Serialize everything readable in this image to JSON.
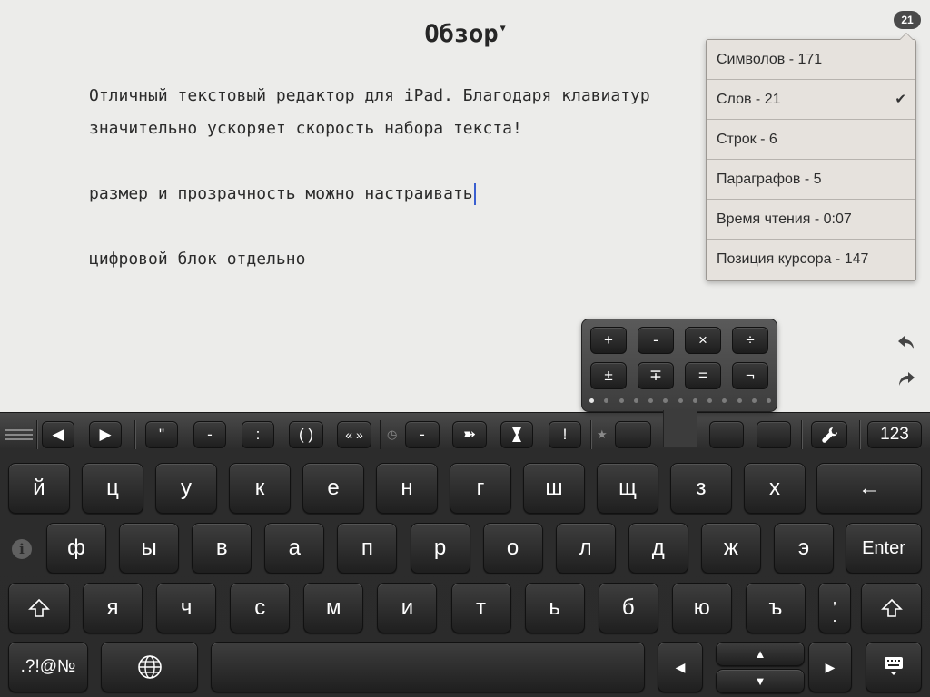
{
  "document": {
    "title": "Обзор",
    "lines": [
      "Отличный текстовый редактор для iPad. Благодаря клавиатур",
      "значительно ускоряет скорость набора текста!",
      "размер и прозрачность можно настраивать",
      "цифровой блок отдельно"
    ]
  },
  "stats": {
    "badge": "21",
    "rows": [
      {
        "label": "Символов - 171",
        "checked": false
      },
      {
        "label": "Слов - 21",
        "checked": true
      },
      {
        "label": "Строк - 6",
        "checked": false
      },
      {
        "label": "Параграфов - 5",
        "checked": false
      },
      {
        "label": "Время чтения - 0:07",
        "checked": false
      },
      {
        "label": "Позиция курсора - 147",
        "checked": false
      }
    ],
    "check_mark": "✔"
  },
  "numpad": {
    "keys": [
      "+",
      "-",
      "×",
      "÷",
      "±",
      "∓",
      "=",
      "¬"
    ],
    "page_count": 13,
    "active_page": 0
  },
  "toolbar": {
    "left_arrow": "◀",
    "right_arrow": "▶",
    "quote": "\"",
    "dash": "-",
    "colon": ":",
    "parens": "( )",
    "guillemets": "« »",
    "dash2": "-",
    "bullet_arrow": "➽",
    "exclaim": "!",
    "num_mode": "123"
  },
  "keyboard": {
    "row1": [
      "й",
      "ц",
      "у",
      "к",
      "е",
      "н",
      "г",
      "ш",
      "щ",
      "з",
      "х"
    ],
    "row2": [
      "ф",
      "ы",
      "в",
      "а",
      "п",
      "р",
      "о",
      "л",
      "д",
      "ж",
      "э"
    ],
    "row3": [
      "я",
      "ч",
      "с",
      "м",
      "и",
      "т",
      "ь",
      "б",
      "ю",
      "ъ"
    ],
    "enter": "Enter",
    "backspace": "←",
    "shift": "⇧",
    "comma_period": ",\n.",
    "symbols": ".?!@№",
    "arrow_left": "◀",
    "arrow_right": "▶",
    "arrow_up": "▲",
    "arrow_down": "▼",
    "info": "i"
  }
}
